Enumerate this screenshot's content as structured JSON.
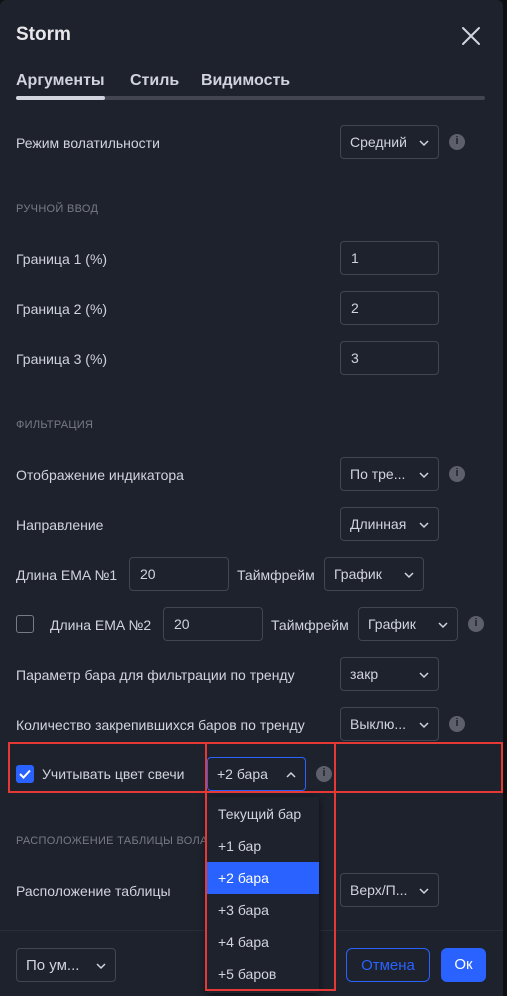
{
  "dialog": {
    "title": "Storm"
  },
  "tabs": [
    {
      "label": "Аргументы",
      "active": true
    },
    {
      "label": "Стиль",
      "active": false
    },
    {
      "label": "Видимость",
      "active": false
    }
  ],
  "volatility": {
    "label": "Режим волатильности",
    "value": "Средний"
  },
  "manual_section": "РУЧНОЙ ВВОД",
  "bounds": [
    {
      "label": "Граница 1 (%)",
      "value": "1"
    },
    {
      "label": "Граница 2 (%)",
      "value": "2"
    },
    {
      "label": "Граница 3 (%)",
      "value": "3"
    }
  ],
  "filter_section": "ФИЛЬТРАЦИЯ",
  "indicator_display": {
    "label": "Отображение индикатора",
    "value": "По тре..."
  },
  "direction": {
    "label": "Направление",
    "value": "Длинная"
  },
  "ema1": {
    "label": "Длина EMA №1",
    "value": "20",
    "tf_label": "Таймфрейм",
    "tf_value": "График"
  },
  "ema2": {
    "label": "Длина EMA №2",
    "value": "20",
    "tf_label": "Таймфрейм",
    "tf_value": "График",
    "checked": false
  },
  "bar_param": {
    "label": "Параметр бара для фильтрации по тренду",
    "value": "закр"
  },
  "bars_count": {
    "label": "Количество закрепившихся баров по тренду",
    "value": "Выклю..."
  },
  "candle_color": {
    "label": "Учитывать цвет свечи",
    "value": "+2 бара",
    "checked": true
  },
  "dropdown": {
    "options": [
      "Текущий бар",
      "+1 бар",
      "+2 бара",
      "+3 бара",
      "+4 бара",
      "+5 баров"
    ],
    "selected": "+2 бара"
  },
  "table_section": "РАСПОЛОЖЕНИЕ ТАБЛИЦЫ ВОЛА",
  "table_position": {
    "label": "Расположение таблицы",
    "value": "Верх/П..."
  },
  "footer": {
    "defaults": "По ум...",
    "cancel": "Отмена",
    "ok": "Ок"
  },
  "colors": {
    "accent": "#2962ff",
    "highlight": "#e53935",
    "background": "#1e222d"
  }
}
